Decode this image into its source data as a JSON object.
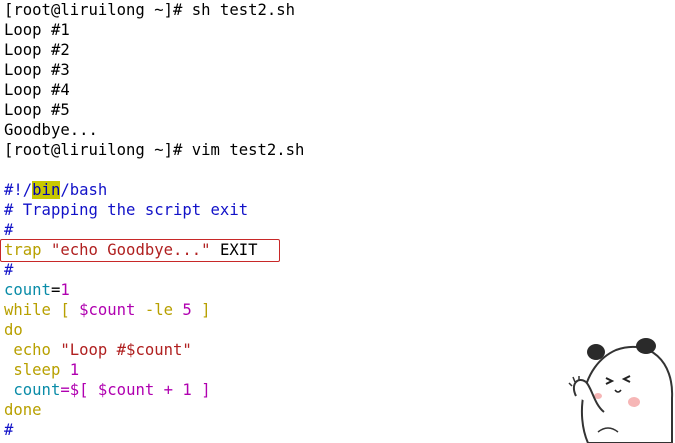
{
  "terminal": {
    "lines": [
      "[root@liruilong ~]# sh test2.sh",
      "Loop #1",
      "Loop #2",
      "Loop #3",
      "Loop #4",
      "Loop #5",
      "Goodbye...",
      "[root@liruilong ~]# vim test2.sh"
    ]
  },
  "code": {
    "shebang_pre": "#!/",
    "shebang_hl": "bin",
    "shebang_post": "/bash",
    "comment1": "# Trapping the script exit",
    "comment2": "#",
    "trap_kw": "trap",
    "trap_str": "\"echo Goodbye...\"",
    "trap_arg": "EXIT",
    "comment3": "#",
    "count_var": "count",
    "count_eq": "=",
    "count_val": "1",
    "while_kw": "while [ ",
    "while_var": "$count",
    "while_op": " -le ",
    "while_num": "5",
    "while_end": " ]",
    "do_kw": "do",
    "echo_kw": " echo ",
    "echo_str": "\"Loop #$count\"",
    "sleep_kw": " sleep ",
    "sleep_num": "1",
    "inc_var": " count",
    "inc_eq": "=$[ ",
    "inc_ref": "$count",
    "inc_op": " + ",
    "inc_num": "1",
    "inc_end": " ]",
    "done_kw": "done",
    "comment4": "#"
  },
  "colors": {
    "comment": "#1212c8",
    "keyword": "#b8a000",
    "string": "#b02020",
    "variable": "#0a8ca8",
    "number": "#b000b0",
    "highlight": "#c8c800",
    "box": "#c82828"
  }
}
